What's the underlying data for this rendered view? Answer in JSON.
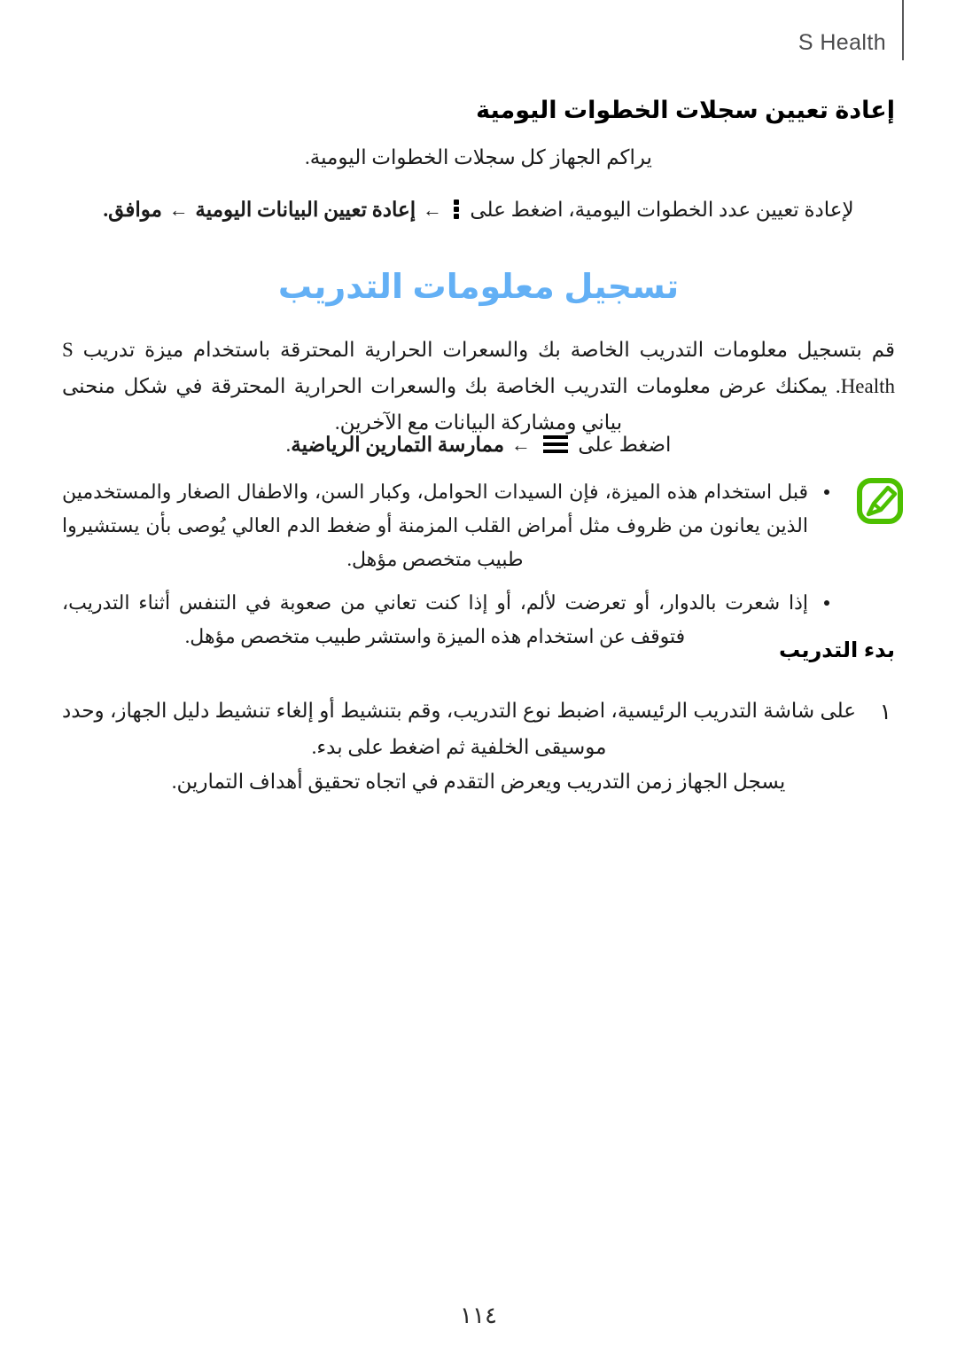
{
  "header": {
    "title": "S Health",
    "rule_color": "#58585a"
  },
  "colors": {
    "heading_blue": "#63b0f5",
    "note_icon_green": "#4DC000",
    "body_text": "#1a1a1a",
    "header_text": "#4b4b4d"
  },
  "reset_section": {
    "heading": "إعادة تعيين سجلات الخطوات اليومية",
    "paragraph": "يراكم الجهاز كل سجلات الخطوات اليومية.",
    "instruction_prefix": "لإعادة تعيين عدد الخطوات اليومية، اضغط على",
    "menu_icon": "overflow-menu-icon",
    "arrow": "←",
    "instruction_step1": "إعادة تعيين البيانات اليومية",
    "instruction_step2": "موافق",
    "instruction_end": "."
  },
  "training_section": {
    "heading": "تسجيل معلومات التدريب",
    "paragraph": "قم بتسجيل معلومات التدريب الخاصة بك والسعرات الحرارية المحترقة باستخدام ميزة تدريب S Health. يمكنك عرض معلومات التدريب الخاصة بك والسعرات الحرارية المحترقة في شكل منحنى بياني ومشاركة البيانات مع الآخرين.",
    "tap_prefix": "اضغط على",
    "menu_icon": "hamburger-menu-icon",
    "arrow": "←",
    "tap_target": "ممارسة التمارين الرياضية",
    "tap_end": "."
  },
  "note": {
    "icon_name": "note-pencil-icon",
    "bullets": [
      "قبل استخدام هذه الميزة، فإن السيدات الحوامل، وكبار السن، والاطفال الصغار والمستخدمين الذين يعانون من ظروف مثل أمراض القلب المزمنة أو ضغط الدم العالي يُوصى بأن يستشيروا طبيب متخصص مؤهل.",
      "إذا شعرت بالدوار، أو تعرضت لألم، أو إذا كنت تعاني من صعوبة في التنفس أثناء التدريب، فتوقف عن استخدام هذه الميزة واستشر طبيب متخصص مؤهل."
    ]
  },
  "start_section": {
    "heading": "بدء التدريب",
    "steps": [
      {
        "number": "١",
        "text": "على شاشة التدريب الرئيسية، اضبط نوع التدريب، وقم بتنشيط أو إلغاء تنشيط دليل الجهاز، وحدد موسيقى الخلفية ثم اضغط على بدء."
      }
    ],
    "after_text": "يسجل الجهاز زمن التدريب ويعرض التقدم في اتجاه تحقيق أهداف التمارين."
  },
  "footer": {
    "page_number": "١١٤"
  }
}
